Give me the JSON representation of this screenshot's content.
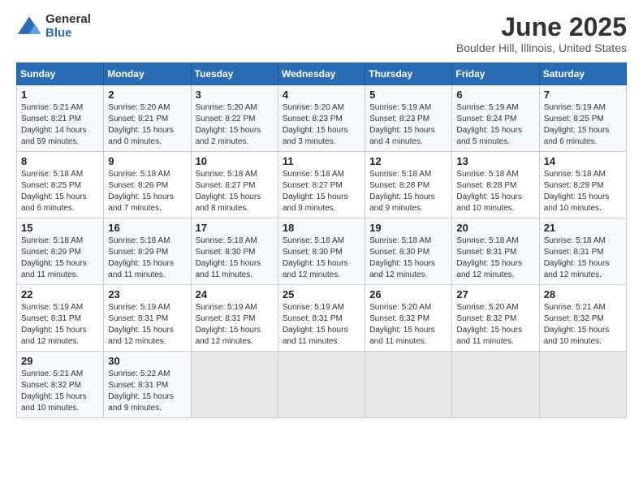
{
  "header": {
    "logo_general": "General",
    "logo_blue": "Blue",
    "title": "June 2025",
    "location": "Boulder Hill, Illinois, United States"
  },
  "days_of_week": [
    "Sunday",
    "Monday",
    "Tuesday",
    "Wednesday",
    "Thursday",
    "Friday",
    "Saturday"
  ],
  "weeks": [
    [
      {
        "day": 1,
        "info": "Sunrise: 5:21 AM\nSunset: 8:21 PM\nDaylight: 14 hours\nand 59 minutes."
      },
      {
        "day": 2,
        "info": "Sunrise: 5:20 AM\nSunset: 8:21 PM\nDaylight: 15 hours\nand 0 minutes."
      },
      {
        "day": 3,
        "info": "Sunrise: 5:20 AM\nSunset: 8:22 PM\nDaylight: 15 hours\nand 2 minutes."
      },
      {
        "day": 4,
        "info": "Sunrise: 5:20 AM\nSunset: 8:23 PM\nDaylight: 15 hours\nand 3 minutes."
      },
      {
        "day": 5,
        "info": "Sunrise: 5:19 AM\nSunset: 8:23 PM\nDaylight: 15 hours\nand 4 minutes."
      },
      {
        "day": 6,
        "info": "Sunrise: 5:19 AM\nSunset: 8:24 PM\nDaylight: 15 hours\nand 5 minutes."
      },
      {
        "day": 7,
        "info": "Sunrise: 5:19 AM\nSunset: 8:25 PM\nDaylight: 15 hours\nand 6 minutes."
      }
    ],
    [
      {
        "day": 8,
        "info": "Sunrise: 5:18 AM\nSunset: 8:25 PM\nDaylight: 15 hours\nand 6 minutes."
      },
      {
        "day": 9,
        "info": "Sunrise: 5:18 AM\nSunset: 8:26 PM\nDaylight: 15 hours\nand 7 minutes."
      },
      {
        "day": 10,
        "info": "Sunrise: 5:18 AM\nSunset: 8:27 PM\nDaylight: 15 hours\nand 8 minutes."
      },
      {
        "day": 11,
        "info": "Sunrise: 5:18 AM\nSunset: 8:27 PM\nDaylight: 15 hours\nand 9 minutes."
      },
      {
        "day": 12,
        "info": "Sunrise: 5:18 AM\nSunset: 8:28 PM\nDaylight: 15 hours\nand 9 minutes."
      },
      {
        "day": 13,
        "info": "Sunrise: 5:18 AM\nSunset: 8:28 PM\nDaylight: 15 hours\nand 10 minutes."
      },
      {
        "day": 14,
        "info": "Sunrise: 5:18 AM\nSunset: 8:29 PM\nDaylight: 15 hours\nand 10 minutes."
      }
    ],
    [
      {
        "day": 15,
        "info": "Sunrise: 5:18 AM\nSunset: 8:29 PM\nDaylight: 15 hours\nand 11 minutes."
      },
      {
        "day": 16,
        "info": "Sunrise: 5:18 AM\nSunset: 8:29 PM\nDaylight: 15 hours\nand 11 minutes."
      },
      {
        "day": 17,
        "info": "Sunrise: 5:18 AM\nSunset: 8:30 PM\nDaylight: 15 hours\nand 11 minutes."
      },
      {
        "day": 18,
        "info": "Sunrise: 5:18 AM\nSunset: 8:30 PM\nDaylight: 15 hours\nand 12 minutes."
      },
      {
        "day": 19,
        "info": "Sunrise: 5:18 AM\nSunset: 8:30 PM\nDaylight: 15 hours\nand 12 minutes."
      },
      {
        "day": 20,
        "info": "Sunrise: 5:18 AM\nSunset: 8:31 PM\nDaylight: 15 hours\nand 12 minutes."
      },
      {
        "day": 21,
        "info": "Sunrise: 5:18 AM\nSunset: 8:31 PM\nDaylight: 15 hours\nand 12 minutes."
      }
    ],
    [
      {
        "day": 22,
        "info": "Sunrise: 5:19 AM\nSunset: 8:31 PM\nDaylight: 15 hours\nand 12 minutes."
      },
      {
        "day": 23,
        "info": "Sunrise: 5:19 AM\nSunset: 8:31 PM\nDaylight: 15 hours\nand 12 minutes."
      },
      {
        "day": 24,
        "info": "Sunrise: 5:19 AM\nSunset: 8:31 PM\nDaylight: 15 hours\nand 12 minutes."
      },
      {
        "day": 25,
        "info": "Sunrise: 5:19 AM\nSunset: 8:31 PM\nDaylight: 15 hours\nand 11 minutes."
      },
      {
        "day": 26,
        "info": "Sunrise: 5:20 AM\nSunset: 8:32 PM\nDaylight: 15 hours\nand 11 minutes."
      },
      {
        "day": 27,
        "info": "Sunrise: 5:20 AM\nSunset: 8:32 PM\nDaylight: 15 hours\nand 11 minutes."
      },
      {
        "day": 28,
        "info": "Sunrise: 5:21 AM\nSunset: 8:32 PM\nDaylight: 15 hours\nand 10 minutes."
      }
    ],
    [
      {
        "day": 29,
        "info": "Sunrise: 5:21 AM\nSunset: 8:32 PM\nDaylight: 15 hours\nand 10 minutes."
      },
      {
        "day": 30,
        "info": "Sunrise: 5:22 AM\nSunset: 8:31 PM\nDaylight: 15 hours\nand 9 minutes."
      },
      null,
      null,
      null,
      null,
      null
    ]
  ]
}
